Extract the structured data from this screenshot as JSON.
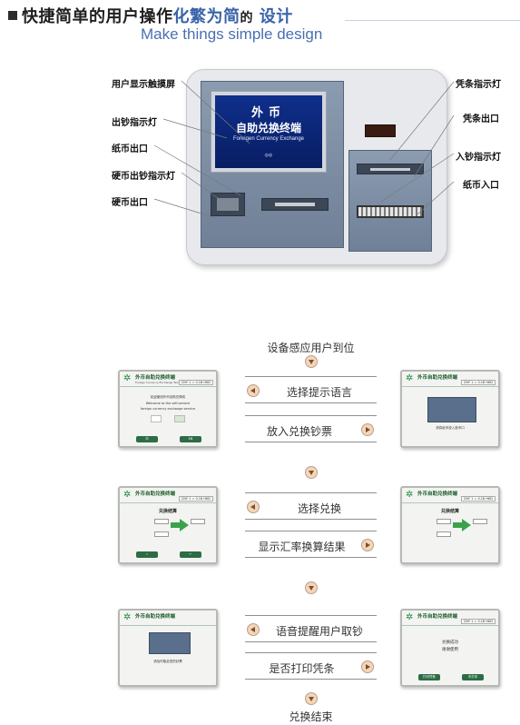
{
  "header": {
    "title_part1": "快捷简单的用户操作",
    "title_part2": "化繁为简",
    "title_part3": "的",
    "title_part4": "设计",
    "subtitle": "Make things simple design"
  },
  "machine": {
    "screen_title": "外币",
    "screen_subtitle": "自助兑换终端",
    "screen_english": "Foreigen Currency Exchange"
  },
  "callouts_left": [
    "用户显示触摸屏",
    "出钞指示灯",
    "纸币出口",
    "硬币出钞指示灯",
    "硬币出口"
  ],
  "callouts_right": [
    "凭条指示灯",
    "凭条出口",
    "入钞指示灯",
    "纸币入口"
  ],
  "flow": {
    "start": "设备感应用户到位",
    "steps": [
      "选择提示语言",
      "放入兑换钞票",
      "选择兑换",
      "显示汇率换算结果",
      "语音提醒用户取钞",
      "是否打印凭条"
    ],
    "end": "兑换结束"
  },
  "mini_screen": {
    "brand": "外币自助兑换终端",
    "brand_en": "Foreign Currency Exchange Terminal",
    "rate": "CNY 1 = 0.18 HKD",
    "welcome_cn": "欢迎使用外币自助兑换机",
    "welcome_en1": "Welcome to the self-service",
    "welcome_en2": "foreign currency exchange service",
    "insert_cn": "请将纸币放入投币口",
    "exchange_title": "兑换结算",
    "take_cash": "请及时取走您的钞票",
    "success": "兑换成功",
    "thanks": "谢谢使用",
    "btn_print": "打印凭条",
    "btn_no_print": "不打印"
  },
  "colors": {
    "accent_blue": "#3a63a8",
    "screen_blue": "#0f2f8c",
    "brand_green": "#1e8a3c"
  }
}
